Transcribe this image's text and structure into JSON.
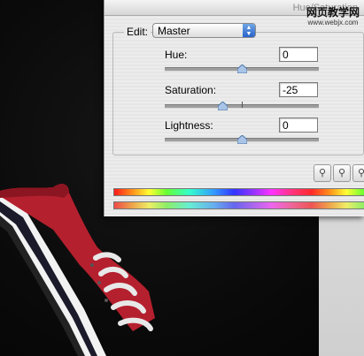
{
  "window": {
    "title": "Hue/Saturation"
  },
  "watermark": {
    "line1": "网页教学网",
    "line2": "www.webjx.com"
  },
  "edit": {
    "label": "Edit:",
    "selected": "Master"
  },
  "hue": {
    "label": "Hue:",
    "value": "0",
    "level": 0.5
  },
  "saturation": {
    "label": "Saturation:",
    "value": "-25",
    "level": 0.375
  },
  "lightness": {
    "label": "Lightness:",
    "value": "0",
    "level": 0.5
  },
  "icons": [
    "eyedropper-icon",
    "eyedropper-plus-icon",
    "eyedropper-minus-icon"
  ]
}
